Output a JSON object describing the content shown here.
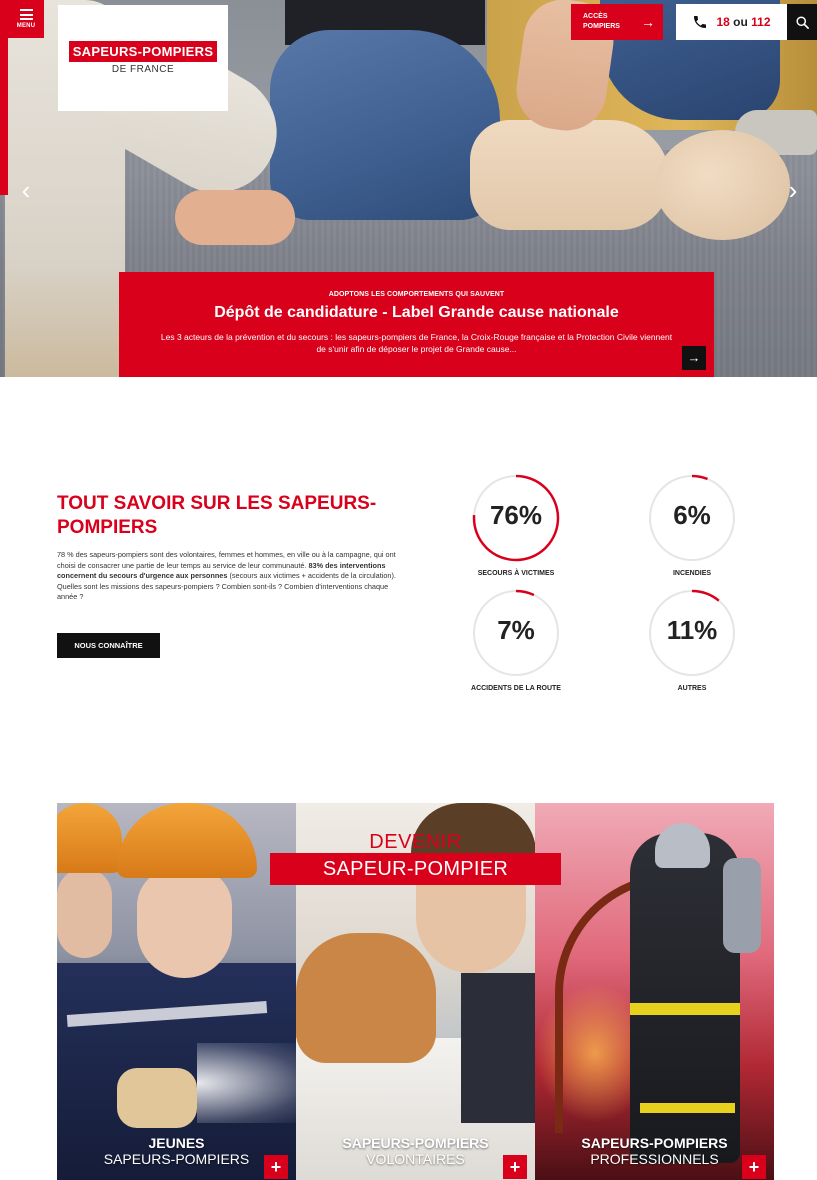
{
  "header": {
    "menu_label": "MENU",
    "logo_line1": "SAPEURS-POMPIERS",
    "logo_line2": "DE FRANCE",
    "acces_label": "ACCÈS POMPIERS",
    "phone_num1": "18",
    "phone_sep": " ou ",
    "phone_num2": "112",
    "icons": {
      "menu": "hamburger-icon",
      "arrow": "arrow-right-icon",
      "phone": "phone-icon",
      "search": "search-icon"
    }
  },
  "hero": {
    "kicker": "ADOPTONS LES COMPORTEMENTS QUI SAUVENT",
    "title": "Dépôt de candidature - Label Grande cause nationale",
    "description": "Les 3 acteurs de la prévention et du secours : les sapeurs-pompiers de France, la Croix-Rouge française et la Protection Civile viennent de s'unir afin de déposer le projet de Grande cause...",
    "prev": "‹",
    "next": "›",
    "go": "→"
  },
  "stats": {
    "title": "TOUT SAVOIR SUR LES SAPEURS-POMPIERS",
    "text_1": "78 % des sapeurs-pompiers sont des volontaires, femmes et hommes, en ville ou à la campagne, qui ont choisi de consacrer une partie de leur temps au service de leur communauté. ",
    "text_bold": "83% des interventions concernent du secours d'urgence aux personnes",
    "text_2": " (secours aux victimes + accidents de la circulation).  Quelles sont les missions des sapeurs-pompiers ? Combien sont-ils ?  Combien d'interventions chaque année ?",
    "button": "NOUS CONNAÎTRE",
    "items": [
      {
        "value": "76%",
        "percent": 76,
        "label": "SECOURS À VICTIMES"
      },
      {
        "value": "6%",
        "percent": 6,
        "label": "INCENDIES"
      },
      {
        "value": "7%",
        "percent": 7,
        "label": "ACCIDENTS DE LA ROUTE"
      },
      {
        "value": "11%",
        "percent": 11,
        "label": "AUTRES"
      }
    ],
    "ring_color": "#d9001b"
  },
  "devenir": {
    "line1": "DEVENIR",
    "line2": "SAPEUR-POMPIER",
    "panels": [
      {
        "a": "JEUNES",
        "b": "SAPEURS-POMPIERS"
      },
      {
        "a": "SAPEURS-POMPIERS",
        "b": "VOLONTAIRES"
      },
      {
        "a": "SAPEURS-POMPIERS",
        "b": "PROFESSIONNELS"
      }
    ],
    "plus": "+"
  },
  "colors": {
    "brand_red": "#d9001b",
    "black": "#111111"
  }
}
